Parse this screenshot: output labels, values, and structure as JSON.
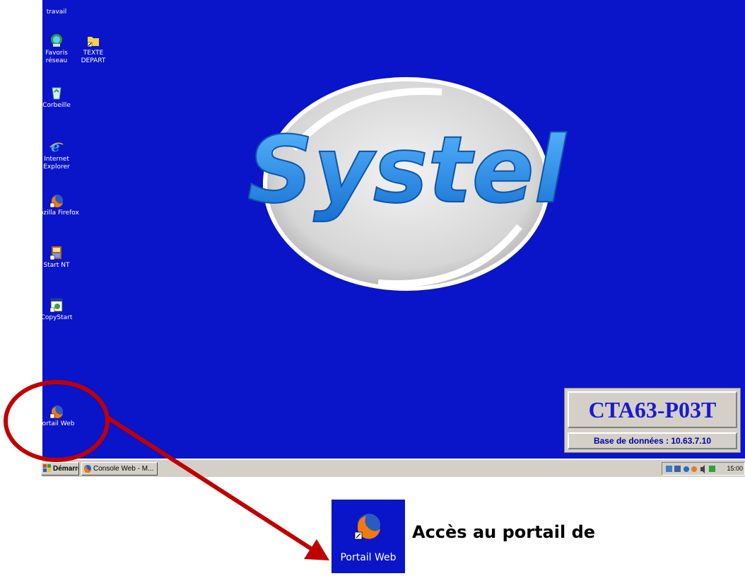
{
  "desktop": {
    "top_partial_label": "travail",
    "icons": [
      {
        "name": "favoris-reseau-icon",
        "label": "Favoris\nréseau"
      },
      {
        "name": "texte-depart-icon",
        "label": "TEXTE\nDEPART"
      },
      {
        "name": "corbeille-icon",
        "label": "Corbeille"
      },
      {
        "name": "internet-explorer-icon",
        "label": "Internet\nExplorer"
      },
      {
        "name": "mozilla-firefox-icon",
        "label": "Mozilla Firefox"
      },
      {
        "name": "start-nt-icon",
        "label": "Start NT"
      },
      {
        "name": "copystart-icon",
        "label": "CopyStart"
      },
      {
        "name": "portail-web-icon",
        "label": "Portail Web"
      }
    ],
    "logo_text": "Systel",
    "infobox": {
      "hostname": "CTA63-P03T",
      "database_line": "Base de données : 10.63.7.10"
    }
  },
  "taskbar": {
    "start_label": "Démarrer",
    "window_button_label": "Console Web - M...",
    "clock": "15:00"
  },
  "callout": {
    "icon_label": "Portail Web",
    "caption": "Accès au portail de"
  },
  "colors": {
    "desktop_bg": "#0a14c8",
    "highlight": "#c00000",
    "logo_blue": "#1e8fe0"
  }
}
